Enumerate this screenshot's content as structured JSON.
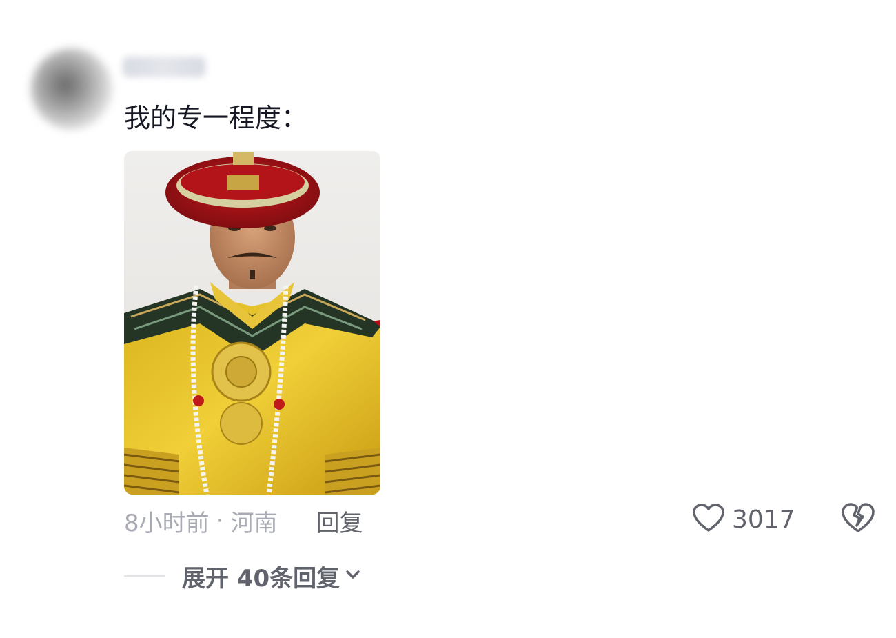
{
  "comment": {
    "text": "我的专一程度：",
    "time": "8小时前",
    "separator": "·",
    "location": "河南",
    "reply_label": "回复",
    "like_count": "3017",
    "expand_label": "展开 40条回复"
  },
  "icons": {
    "like": "heart-outline-icon",
    "dislike": "broken-heart-icon",
    "expand": "chevron-down-icon"
  },
  "colors": {
    "text_primary": "#161823",
    "text_muted": "#a8abb3",
    "text_secondary": "#60636b"
  }
}
